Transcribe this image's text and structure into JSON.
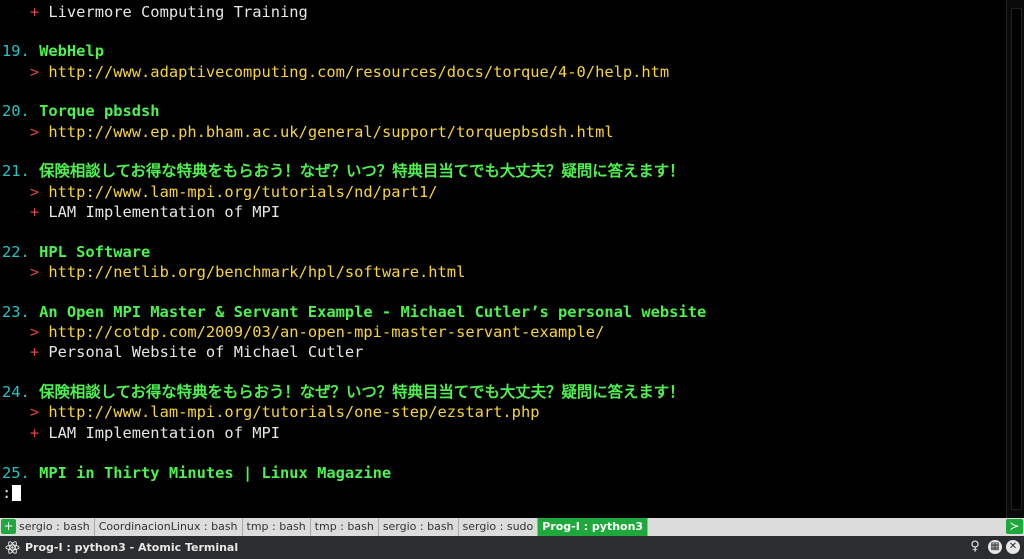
{
  "terminal": {
    "lines": [
      {
        "num": "",
        "title": "",
        "mark": "+",
        "text": "Livermore Computing Training",
        "kind": "desc"
      },
      {
        "num": "19.",
        "title": "WebHelp",
        "mark": "",
        "text": "",
        "kind": "title"
      },
      {
        "num": "",
        "title": "",
        "mark": ">",
        "text": "http://www.adaptivecomputing.com/resources/docs/torque/4-0/help.htm",
        "kind": "url"
      },
      {
        "num": "20.",
        "title": "Torque pbsdsh",
        "mark": "",
        "text": "",
        "kind": "title"
      },
      {
        "num": "",
        "title": "",
        "mark": ">",
        "text": "http://www.ep.ph.bham.ac.uk/general/support/torquepbsdsh.html",
        "kind": "url"
      },
      {
        "num": "21.",
        "title": "保険相談してお得な特典をもらおう！なぜ？いつ？特典目当てでも大丈夫？疑問に答えます！",
        "mark": "",
        "text": "",
        "kind": "title"
      },
      {
        "num": "",
        "title": "",
        "mark": ">",
        "text": "http://www.lam-mpi.org/tutorials/nd/part1/",
        "kind": "url"
      },
      {
        "num": "",
        "title": "",
        "mark": "+",
        "text": "LAM Implementation of MPI",
        "kind": "desc"
      },
      {
        "num": "22.",
        "title": "HPL Software",
        "mark": "",
        "text": "",
        "kind": "title"
      },
      {
        "num": "",
        "title": "",
        "mark": ">",
        "text": "http://netlib.org/benchmark/hpl/software.html",
        "kind": "url"
      },
      {
        "num": "23.",
        "title": "An Open MPI Master & Servant Example - Michael Cutler’s personal website",
        "mark": "",
        "text": "",
        "kind": "title"
      },
      {
        "num": "",
        "title": "",
        "mark": ">",
        "text": "http://cotdp.com/2009/03/an-open-mpi-master-servant-example/",
        "kind": "url"
      },
      {
        "num": "",
        "title": "",
        "mark": "+",
        "text": "Personal Website of Michael Cutler",
        "kind": "desc"
      },
      {
        "num": "24.",
        "title": "保険相談してお得な特典をもらおう！なぜ？いつ？特典目当てでも大丈夫？疑問に答えます！",
        "mark": "",
        "text": "",
        "kind": "title"
      },
      {
        "num": "",
        "title": "",
        "mark": ">",
        "text": "http://www.lam-mpi.org/tutorials/one-step/ezstart.php",
        "kind": "url"
      },
      {
        "num": "",
        "title": "",
        "mark": "+",
        "text": "LAM Implementation of MPI",
        "kind": "desc"
      },
      {
        "num": "25.",
        "title": "MPI in Thirty Minutes | Linux Magazine",
        "mark": "",
        "text": "",
        "kind": "title"
      }
    ],
    "prompt": ":"
  },
  "tabbar": {
    "new_tab_icon": "terminal-plus-icon",
    "tabs": [
      {
        "label": "sergio : bash",
        "active": false
      },
      {
        "label": "CoordinacionLinux : bash",
        "active": false
      },
      {
        "label": "tmp : bash",
        "active": false
      },
      {
        "label": "tmp : bash",
        "active": false
      },
      {
        "label": "sergio : bash",
        "active": false
      },
      {
        "label": "sergio : sudo",
        "active": false
      },
      {
        "label": "Prog-I : python3",
        "active": true
      }
    ],
    "right_icon": "terminal-icon"
  },
  "statusbar": {
    "window_title": "Prog-I : python3 - Atomic Terminal",
    "app_icon": "atom-icon",
    "buttons": [
      "bulb-icon",
      "maximize-icon",
      "close-icon"
    ]
  },
  "colors": {
    "background": "#000000",
    "number": "#27c4c4",
    "title": "#4ff04f",
    "marker": "#e0443e",
    "url": "#f7d43a",
    "description": "#e6e6e6",
    "accent": "#1fa83b"
  }
}
